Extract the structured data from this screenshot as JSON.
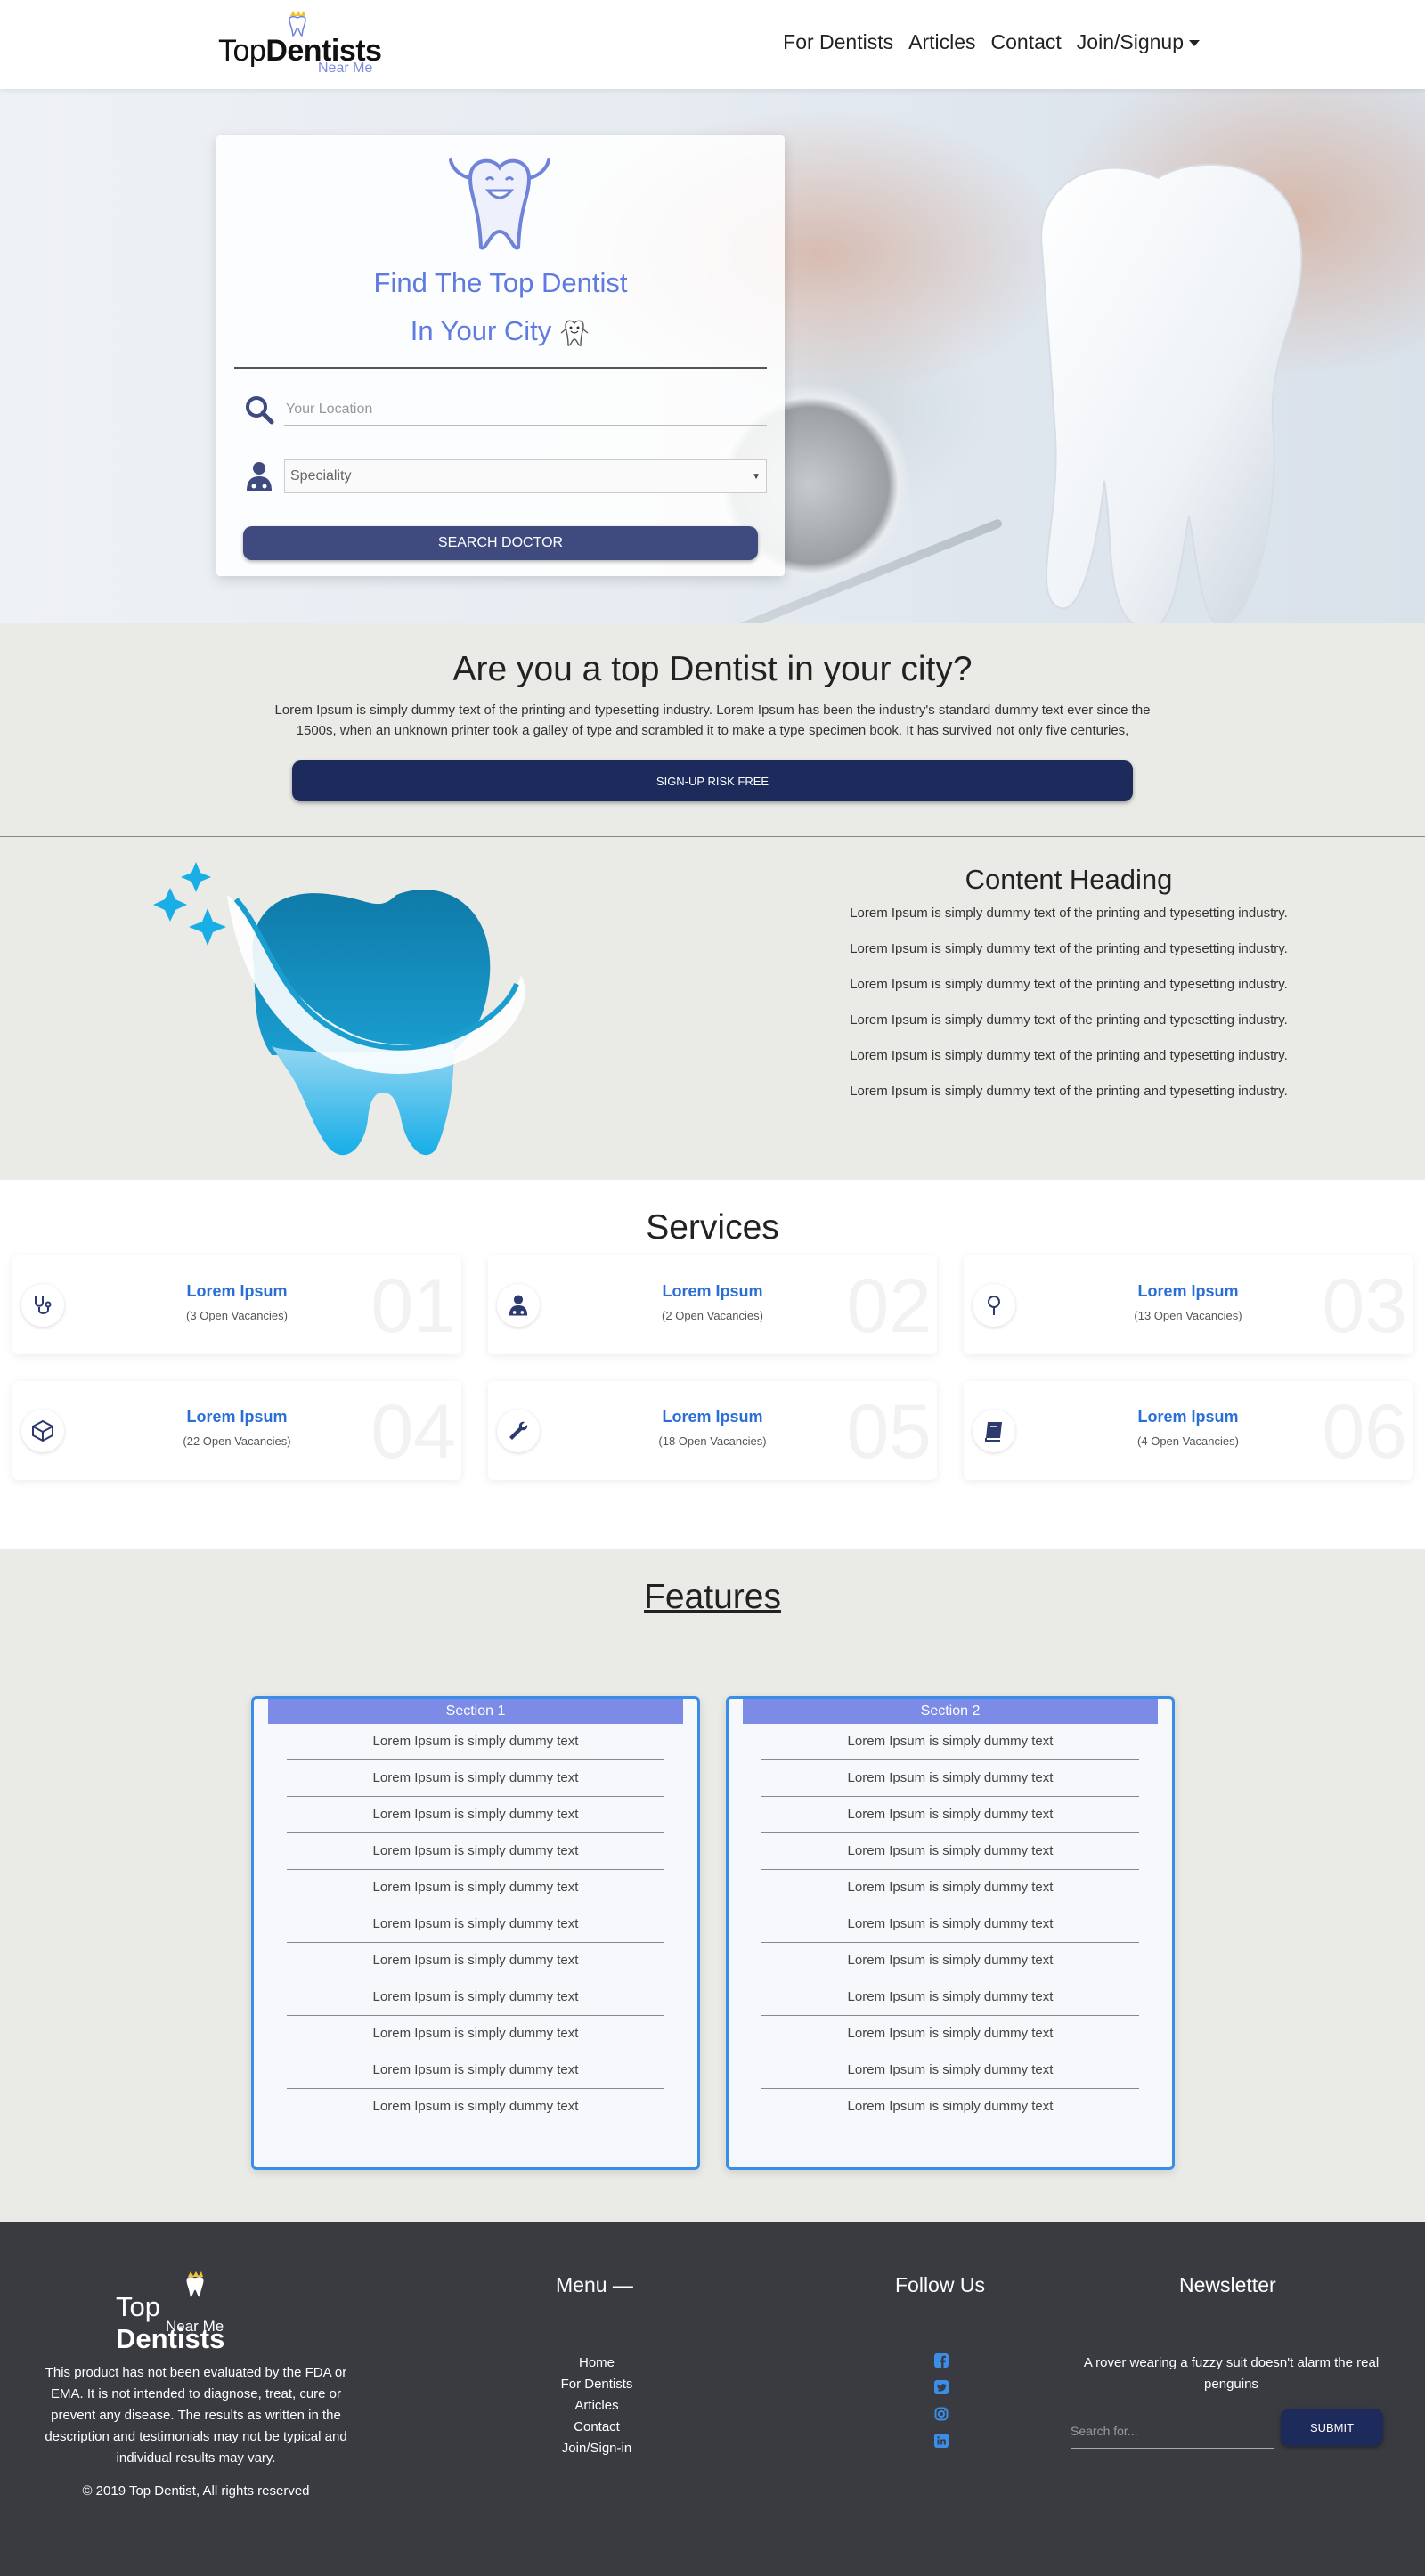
{
  "brand": {
    "name_part1": "Top",
    "name_part2": "Dentists",
    "tagline": "Near Me"
  },
  "nav": {
    "items": [
      {
        "label": "For Dentists"
      },
      {
        "label": "Articles"
      },
      {
        "label": "Contact"
      },
      {
        "label": "Join/Signup"
      }
    ]
  },
  "hero": {
    "title_line1": "Find The Top Dentist",
    "title_line2": "In Your City",
    "location_placeholder": "Your Location",
    "speciality_value": "Speciality",
    "search_button": "SEARCH DOCTOR",
    "accent_color": "#5f7ae0"
  },
  "cta": {
    "heading": "Are you a top Dentist in your city?",
    "text": "Lorem Ipsum is simply dummy text of the printing and typesetting industry. Lorem Ipsum has been the industry's standard dummy text ever since the 1500s, when an unknown printer took a galley of type and scrambled it to make a type specimen book. It has survived not only five centuries,",
    "button": "SIGN-UP RISK FREE"
  },
  "content": {
    "heading": "Content Heading",
    "lines": [
      "Lorem Ipsum is simply dummy text of the printing and typesetting industry.",
      "Lorem Ipsum is simply dummy text of the printing and typesetting industry.",
      "Lorem Ipsum is simply dummy text of the printing and typesetting industry.",
      "Lorem Ipsum is simply dummy text of the printing and typesetting industry.",
      "Lorem Ipsum is simply dummy text of the printing and typesetting industry.",
      "Lorem Ipsum is simply dummy text of the printing and typesetting industry."
    ]
  },
  "services": {
    "heading": "Services",
    "items": [
      {
        "title": "Lorem Ipsum",
        "subtitle": "(3 Open Vacancies)",
        "number": "01",
        "icon": "stethoscope-icon"
      },
      {
        "title": "Lorem Ipsum",
        "subtitle": "(2 Open Vacancies)",
        "number": "02",
        "icon": "doctor-icon"
      },
      {
        "title": "Lorem Ipsum",
        "subtitle": "(13 Open Vacancies)",
        "number": "03",
        "icon": "mirror-icon"
      },
      {
        "title": "Lorem Ipsum",
        "subtitle": "(22 Open Vacancies)",
        "number": "04",
        "icon": "cube-icon"
      },
      {
        "title": "Lorem Ipsum",
        "subtitle": "(18 Open Vacancies)",
        "number": "05",
        "icon": "wrench-icon"
      },
      {
        "title": "Lorem Ipsum",
        "subtitle": "(4 Open Vacancies)",
        "number": "06",
        "icon": "book-icon"
      }
    ]
  },
  "features": {
    "heading": "Features",
    "sections": [
      {
        "title": "Section 1",
        "items": [
          "Lorem Ipsum is simply dummy text",
          "Lorem Ipsum is simply dummy text",
          "Lorem Ipsum is simply dummy text",
          "Lorem Ipsum is simply dummy text",
          "Lorem Ipsum is simply dummy text",
          "Lorem Ipsum is simply dummy text",
          "Lorem Ipsum is simply dummy text",
          "Lorem Ipsum is simply dummy text",
          "Lorem Ipsum is simply dummy text",
          "Lorem Ipsum is simply dummy text",
          "Lorem Ipsum is simply dummy text"
        ]
      },
      {
        "title": "Section 2",
        "items": [
          "Lorem Ipsum is simply dummy text",
          "Lorem Ipsum is simply dummy text",
          "Lorem Ipsum is simply dummy text",
          "Lorem Ipsum is simply dummy text",
          "Lorem Ipsum is simply dummy text",
          "Lorem Ipsum is simply dummy text",
          "Lorem Ipsum is simply dummy text",
          "Lorem Ipsum is simply dummy text",
          "Lorem Ipsum is simply dummy text",
          "Lorem Ipsum is simply dummy text",
          "Lorem Ipsum is simply dummy text"
        ]
      }
    ]
  },
  "footer": {
    "disclaimer": "This product has not been evaluated by the FDA or EMA. It is not intended to diagnose, treat, cure or prevent any disease. The results as written in the description and testimonials may not be typical and individual results may vary.",
    "copyright": "© 2019 Top Dentist, All rights reserved",
    "menu_title": "Menu —",
    "menu_items": [
      "Home",
      "For Dentists",
      "Articles",
      "Contact",
      "Join/Sign-in"
    ],
    "follow_title": "Follow Us",
    "social_icons": [
      "facebook-icon",
      "twitter-icon",
      "instagram-icon",
      "linkedin-icon"
    ],
    "newsletter_title": "Newsletter",
    "newsletter_text": "A rover wearing a fuzzy suit doesn't alarm the real penguins",
    "newsletter_placeholder": "Search for...",
    "submit_button": "SUBMIT"
  }
}
